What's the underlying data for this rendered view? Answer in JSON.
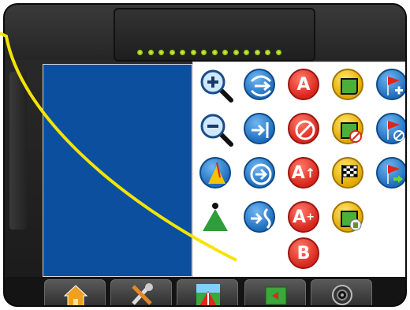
{
  "lightbar": {
    "led_count": 14,
    "led_color": "#b8e62a"
  },
  "map": {
    "background": "#0b4f9e"
  },
  "panel": {
    "buttons": [
      {
        "name": "zoom-in-icon",
        "shape": "magnifier-plus"
      },
      {
        "name": "curve-guidance-icon",
        "shape": "curve"
      },
      {
        "name": "mark-a-button",
        "letter": "A"
      },
      {
        "name": "boundary-icon",
        "shape": "boundary"
      },
      {
        "name": "add-flag-icon",
        "shape": "flag-plus"
      },
      {
        "name": "zoom-out-icon",
        "shape": "magnifier-minus"
      },
      {
        "name": "nudge-icon",
        "shape": "arrow-line"
      },
      {
        "name": "cancel-icon",
        "shape": "no"
      },
      {
        "name": "cancel-boundary-icon",
        "shape": "boundary-no"
      },
      {
        "name": "delete-flag-icon",
        "shape": "flag-no"
      },
      {
        "name": "vehicle-view-icon",
        "shape": "cone"
      },
      {
        "name": "next-icon",
        "shape": "circle-arrow"
      },
      {
        "name": "a-plus-nudge-button",
        "letter": "A",
        "sup": "↑"
      },
      {
        "name": "checkered-flag-icon",
        "shape": "checker"
      },
      {
        "name": "goto-flag-icon",
        "shape": "flag-arrow"
      },
      {
        "name": "perspective-view-icon",
        "shape": "triangle"
      },
      {
        "name": "merge-icon",
        "shape": "merge"
      },
      {
        "name": "a-plus-button",
        "letter": "A",
        "sup": "+"
      },
      {
        "name": "delete-boundary-icon",
        "shape": "boundary-trash"
      },
      {
        "name": "mark-b-button",
        "letter": "B"
      }
    ]
  },
  "tabs": [
    {
      "name": "tab-home",
      "icon": "home-icon"
    },
    {
      "name": "tab-tools",
      "icon": "tools-icon"
    },
    {
      "name": "tab-guidance",
      "icon": "guidance-icon"
    },
    {
      "name": "tab-map",
      "icon": "map-icon"
    },
    {
      "name": "tab-camera",
      "icon": "camera-icon"
    }
  ],
  "colors": {
    "accent_yellow": "#f5e400",
    "button_blue": "#1f6dbd",
    "button_red": "#d8261c",
    "button_gold": "#e0a800"
  }
}
